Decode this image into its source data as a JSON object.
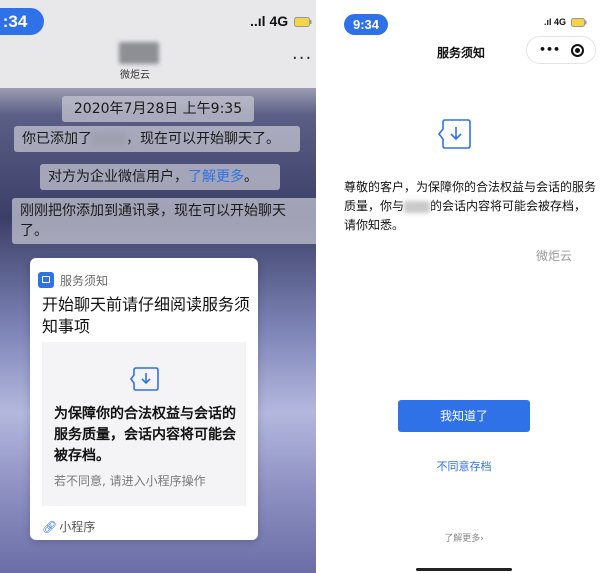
{
  "left": {
    "status": {
      "time": ":34",
      "signal": "..ıl 4G"
    },
    "header": {
      "name": "微炬云",
      "more": "···"
    },
    "messages": {
      "date": "2020年7月28日 上午9:35",
      "added_prefix": "你已添加了",
      "added_suffix": "，现在可以开始聊天了。",
      "corp_text": "对方为企业微信用户，",
      "corp_link": "了解更多",
      "corp_end": "。",
      "address": "刚刚把你添加到通讯录，现在可以开始聊天了。"
    },
    "card": {
      "service_label": "服务须知",
      "title": "开始聊天前请仔细阅读服务须知事项",
      "bold_text": "为保障你的合法权益与会话的服务质量，会话内容将可能会被存档。",
      "note": "若不同意, 请进入小程序操作",
      "mini_program": "小程序"
    }
  },
  "right": {
    "status": {
      "time": "9:34",
      "signal": ".ıl 4G"
    },
    "title": "服务须知",
    "body_prefix": "尊敬的客户，为保障你的合法权益与会话的服务质量，你与",
    "body_suffix": "的会话内容将可能会被存档，请你知悉。",
    "signature": "微炬云",
    "agree_button": "我知道了",
    "disagree_link": "不同意存档",
    "learn_more": "了解更多›"
  },
  "colors": {
    "accent": "#2f72e8"
  },
  "icons": [
    "download-box-icon",
    "battery-icon",
    "more-dots-icon",
    "close-circle-icon",
    "link-icon"
  ]
}
